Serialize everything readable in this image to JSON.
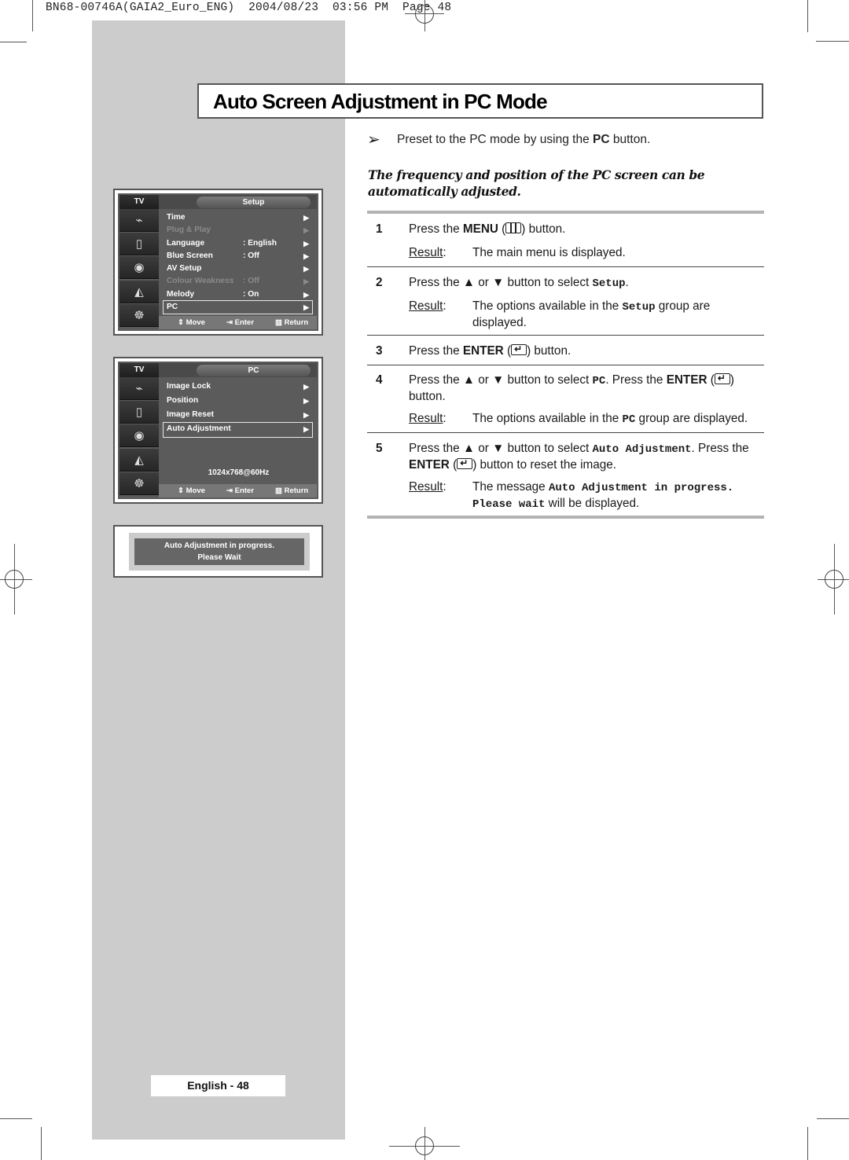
{
  "print_header": {
    "doc_code": "BN68-00746A(GAIA2_Euro_ENG)",
    "date": "2004/08/23",
    "time": "03:56 PM",
    "page_label": "Page 48"
  },
  "title": "Auto Screen Adjustment in PC Mode",
  "note": {
    "icon": "arrow-right-icon",
    "text_before": "Preset to the PC mode by using the ",
    "bold": "PC",
    "text_after": " button."
  },
  "intro": "The frequency and position of the PC screen can be automatically adjusted.",
  "setup_menu": {
    "tv_label": "TV",
    "title": "Setup",
    "icons": [
      "antenna-icon",
      "screen-icon",
      "speaker-icon",
      "channel-icon",
      "setup-icon"
    ],
    "items": [
      {
        "label": "Time",
        "value": "",
        "enabled": true
      },
      {
        "label": "Plug & Play",
        "value": "",
        "enabled": false
      },
      {
        "label": "Language",
        "value": ": English",
        "enabled": true
      },
      {
        "label": "Blue Screen",
        "value": ": Off",
        "enabled": true
      },
      {
        "label": "AV Setup",
        "value": "",
        "enabled": true
      },
      {
        "label": "Colour Weakness",
        "value": ": Off",
        "enabled": false
      },
      {
        "label": "Melody",
        "value": ": On",
        "enabled": true
      },
      {
        "label": "PC",
        "value": "",
        "enabled": true,
        "selected": true
      }
    ],
    "arrow": "▶",
    "footer": {
      "move": "Move",
      "enter": "Enter",
      "return": "Return"
    }
  },
  "pc_menu": {
    "tv_label": "TV",
    "title": "PC",
    "items": [
      {
        "label": "Image Lock"
      },
      {
        "label": "Position"
      },
      {
        "label": "Image Reset"
      },
      {
        "label": "Auto Adjustment",
        "selected": true
      }
    ],
    "arrow": "▶",
    "resolution": "1024x768@60Hz",
    "footer": {
      "move": "Move",
      "enter": "Enter",
      "return": "Return"
    }
  },
  "progress_message": {
    "line1": "Auto Adjustment in progress.",
    "line2": "Please Wait"
  },
  "steps": [
    {
      "num": "1",
      "parts": [
        "Press the ",
        "MENU",
        " (",
        ") button."
      ],
      "result_label": "Result",
      "result": "The main menu is displayed."
    },
    {
      "num": "2",
      "parts": [
        "Press the ▲ or ▼ button to select ",
        "Setup",
        "."
      ],
      "result_label": "Result",
      "result_parts": [
        "The options available in the ",
        "Setup",
        " group are displayed."
      ]
    },
    {
      "num": "3",
      "parts": [
        "Press the ",
        "ENTER",
        " (",
        ") button."
      ]
    },
    {
      "num": "4",
      "parts": [
        "Press the ▲ or ▼ button to select ",
        "PC",
        ". Press the ",
        "ENTER",
        " (",
        ") button."
      ],
      "result_label": "Result",
      "result_parts": [
        "The options available in the ",
        "PC",
        " group are displayed."
      ]
    },
    {
      "num": "5",
      "parts": [
        "Press the ▲ or ▼ button to select ",
        "Auto Adjustment",
        ". Press the ",
        "ENTER",
        " (",
        ") button to reset the image."
      ],
      "result_label": "Result",
      "result_parts": [
        "The message ",
        "Auto Adjustment in progress. Please wait",
        " will be displayed."
      ]
    }
  ],
  "page_footer": "English - 48"
}
